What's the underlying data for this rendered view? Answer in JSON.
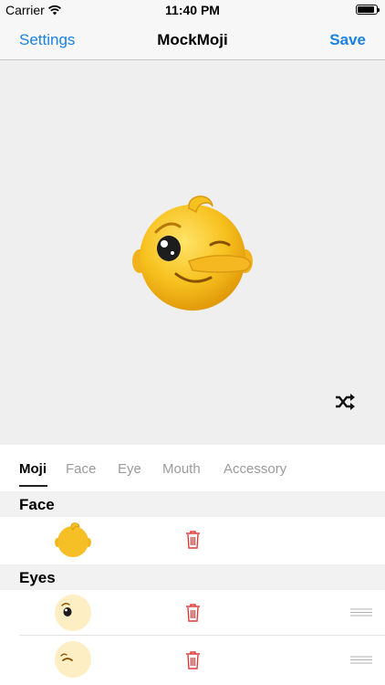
{
  "status_bar": {
    "carrier": "Carrier",
    "time": "11:40 PM",
    "battery_level": 0.9
  },
  "nav": {
    "left_label": "Settings",
    "title": "MockMoji",
    "right_label": "Save"
  },
  "tabs": [
    {
      "label": "Moji",
      "active": true
    },
    {
      "label": "Face",
      "active": false
    },
    {
      "label": "Eye",
      "active": false
    },
    {
      "label": "Mouth",
      "active": false
    },
    {
      "label": "Accessory",
      "active": false
    }
  ],
  "sections": [
    {
      "title": "Face",
      "items": [
        {
          "icon": "face-shape-icon"
        }
      ]
    },
    {
      "title": "Eyes",
      "items": [
        {
          "icon": "eye-open-icon"
        },
        {
          "icon": "eye-closed-icon"
        }
      ]
    }
  ],
  "colors": {
    "accent": "#1a82e2",
    "delete": "#e03a3a",
    "face": "#f6bf26"
  }
}
